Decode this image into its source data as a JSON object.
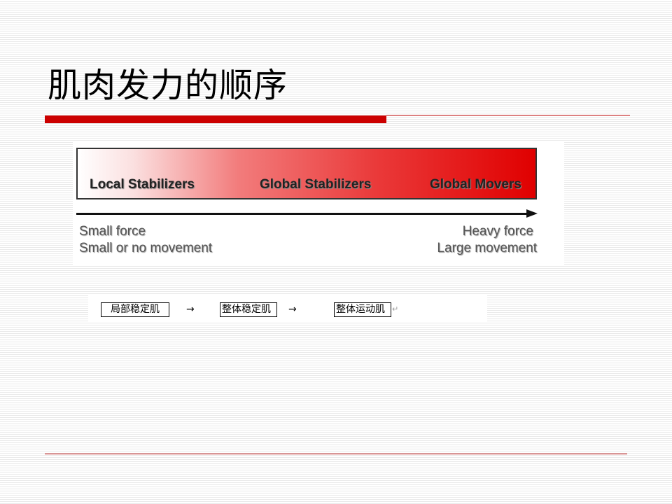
{
  "slide": {
    "title": "肌肉发力的顺序"
  },
  "diagram": {
    "categories": [
      "Local Stabilizers",
      "Global Stabilizers",
      "Global Movers"
    ],
    "left_labels": [
      "Small force",
      "Small or no movement"
    ],
    "right_labels": [
      "Heavy force",
      "Large movement"
    ],
    "gradient_colors": [
      "#ffffff",
      "#e00000"
    ]
  },
  "flow": {
    "steps": [
      "局部稳定肌",
      "整体稳定肌",
      "整体运动肌"
    ],
    "arrow": "→",
    "paragraph_mark": "↵"
  },
  "colors": {
    "accent": "#cc0000",
    "background_lines": "#e9e9e9"
  }
}
